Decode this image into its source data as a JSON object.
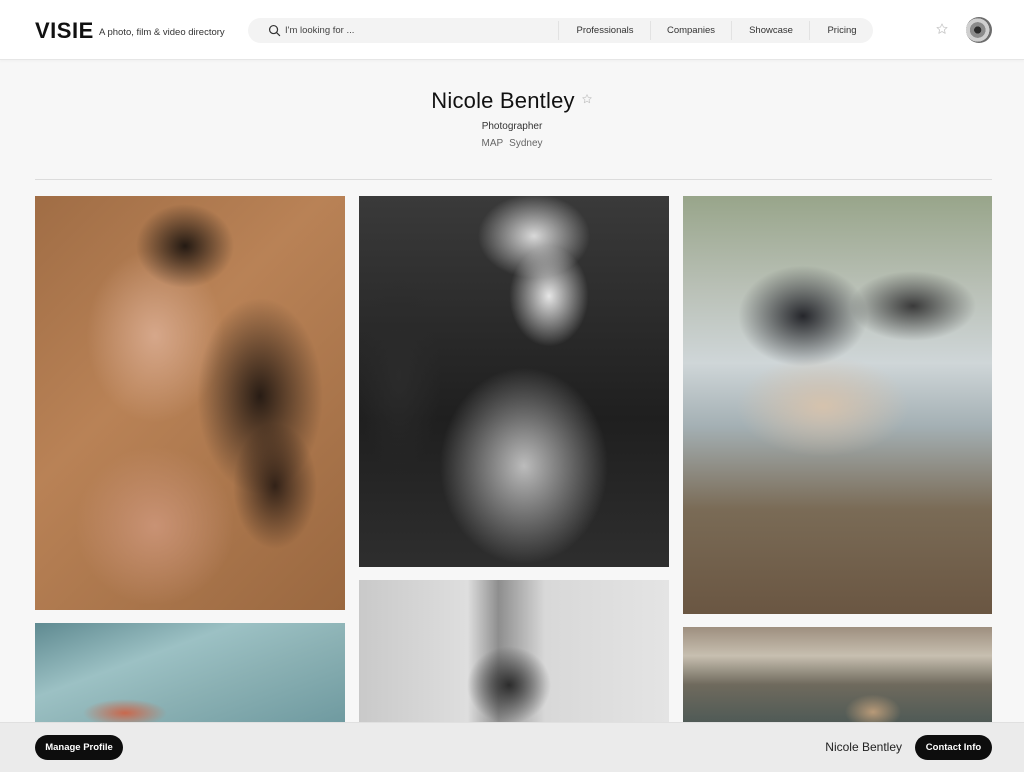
{
  "header": {
    "logo": "VISIE",
    "tagline": "A photo, film & video directory",
    "search_placeholder": "I'm looking for ...",
    "nav": [
      "Professionals",
      "Companies",
      "Showcase",
      "Pricing"
    ]
  },
  "profile": {
    "name": "Nicole Bentley",
    "role": "Photographer",
    "map_label": "MAP",
    "location": "Sydney"
  },
  "gallery": {
    "photos": [
      "portrait-wet-hair",
      "silver-dress-laughing",
      "woman-on-bench-lake",
      "swimsuit-by-pool",
      "bw-portrait-hands",
      "lake-scene"
    ]
  },
  "footer": {
    "manage_label": "Manage Profile",
    "name": "Nicole Bentley",
    "contact_label": "Contact Info"
  },
  "colors": {
    "accent_dark": "#0d0d0d",
    "page_bg": "#f7f7f7",
    "header_bg": "#ffffff",
    "footer_bg": "#ebebeb"
  }
}
